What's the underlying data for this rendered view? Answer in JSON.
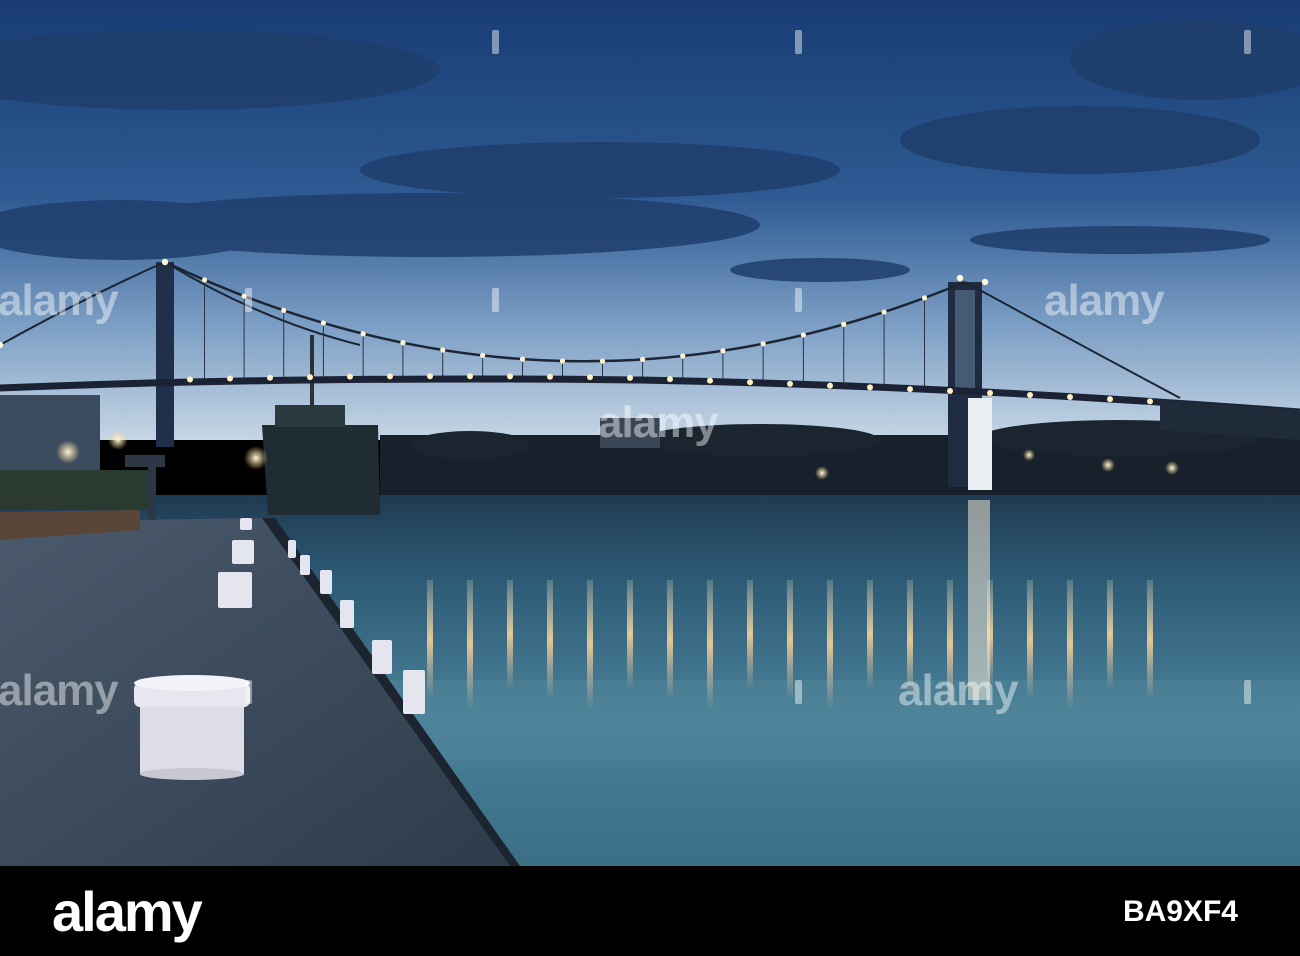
{
  "watermark": {
    "brand": "alamy"
  },
  "footer": {
    "logo": "alamy",
    "image_id": "BA9XF4"
  },
  "colors": {
    "sky_top": "#1a3a6e",
    "sky_horizon": "#c9d7e4",
    "water": "#3f7389",
    "light": "#ffe2a8",
    "footer_bg": "#000000"
  }
}
